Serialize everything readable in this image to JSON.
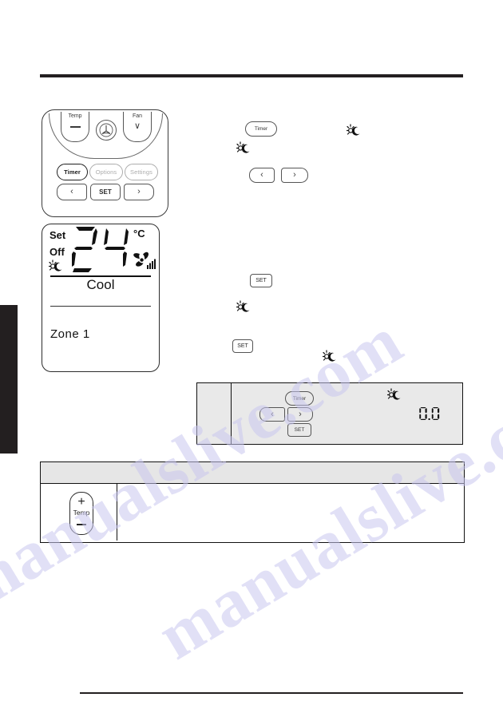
{
  "page": {
    "watermark": "manualslive.com"
  },
  "remote": {
    "name": "wired-remote-controller",
    "temp_button": {
      "label": "Temp",
      "glyph": "−"
    },
    "power_button": {
      "icon": "power-fan-icon"
    },
    "fan_button": {
      "label": "Fan",
      "glyph": "∨"
    },
    "timer_button": "Timer",
    "options_button": "Options",
    "settings_button": "Settings",
    "left_button": "‹",
    "set_button": "SET",
    "right_button": "›"
  },
  "lcd": {
    "set_label": "Set",
    "off_label": "Off",
    "sleep_icon": "sun-moon-icon",
    "temperature": "24",
    "unit": "°C",
    "fan_icon": "fan-speed-icon",
    "mode": "Cool",
    "zone": "Zone 1"
  },
  "right_column": {
    "timer_button": "Timer",
    "sleep_icon_1": "sun-moon-icon",
    "sleep_icon_2": "sun-moon-icon",
    "left_button": "‹",
    "right_button": "›",
    "set_button_1": "SET",
    "sleep_icon_3": "sun-moon-icon",
    "set_button_2": "SET",
    "sleep_icon_4": "sun-moon-icon"
  },
  "diagram_box": {
    "timer_button": "Timer",
    "left_button": "‹",
    "right_button": "›",
    "set_button": "SET",
    "sleep_icon": "sun-moon-icon",
    "display_value": "0.0"
  },
  "bottom_table": {
    "header_text": "",
    "row": {
      "button": {
        "plus": "+",
        "label": "Temp",
        "minus": "−"
      },
      "description": ""
    }
  }
}
